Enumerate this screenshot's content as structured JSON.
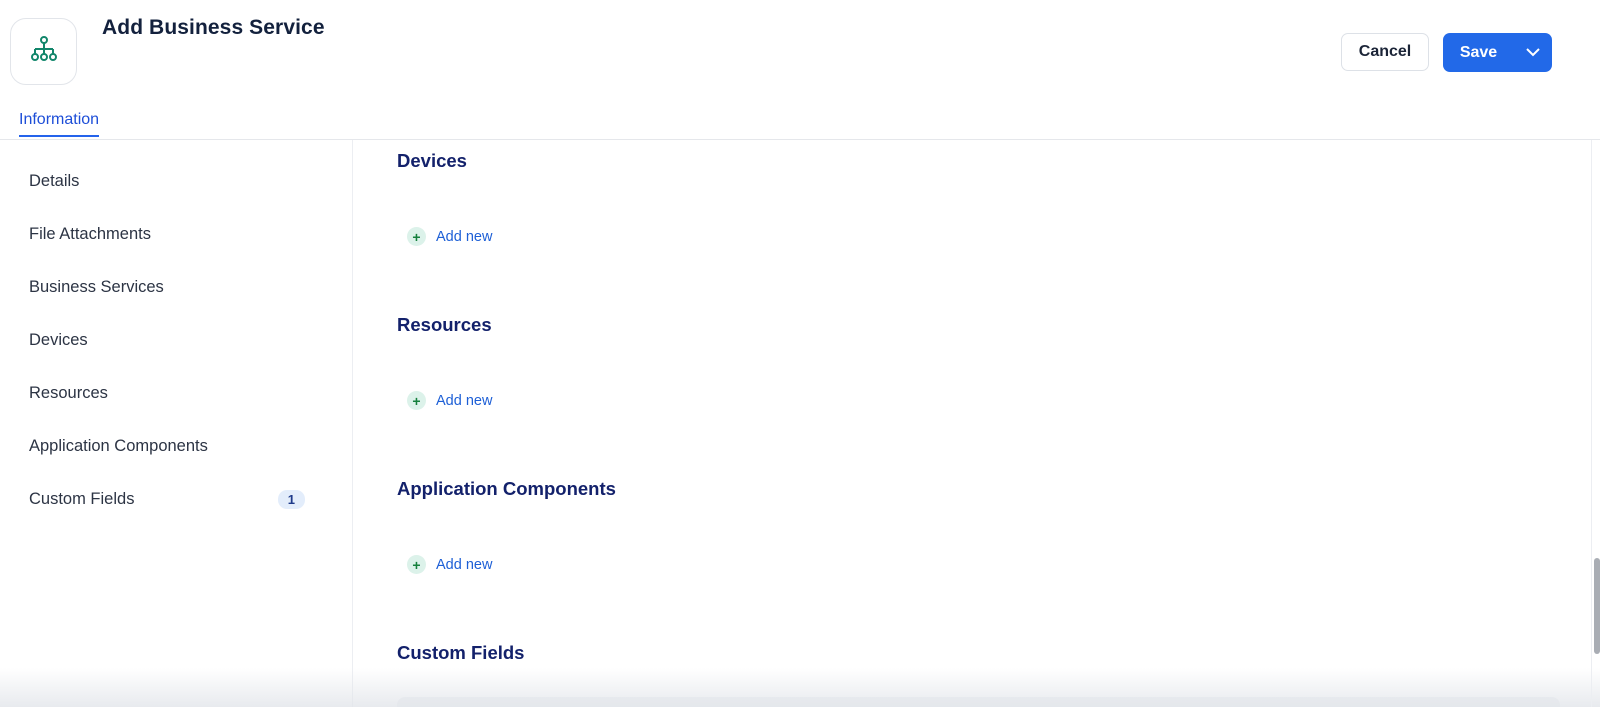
{
  "header": {
    "title": "Add Business Service",
    "logo_icon": "hierarchy-icon",
    "cancel_label": "Cancel",
    "save_label": "Save",
    "accent_color": "#2269e8"
  },
  "tabs": [
    {
      "label": "Information",
      "active": true
    }
  ],
  "sidebar": {
    "items": [
      {
        "label": "Details"
      },
      {
        "label": "File Attachments"
      },
      {
        "label": "Business Services"
      },
      {
        "label": "Devices"
      },
      {
        "label": "Resources"
      },
      {
        "label": "Application Components"
      },
      {
        "label": "Custom Fields",
        "badge": "1"
      }
    ]
  },
  "main": {
    "sections": [
      {
        "title": "Devices",
        "add_label": "Add new"
      },
      {
        "title": "Resources",
        "add_label": "Add new"
      },
      {
        "title": "Application Components",
        "add_label": "Add new"
      },
      {
        "title": "Custom Fields"
      }
    ]
  }
}
